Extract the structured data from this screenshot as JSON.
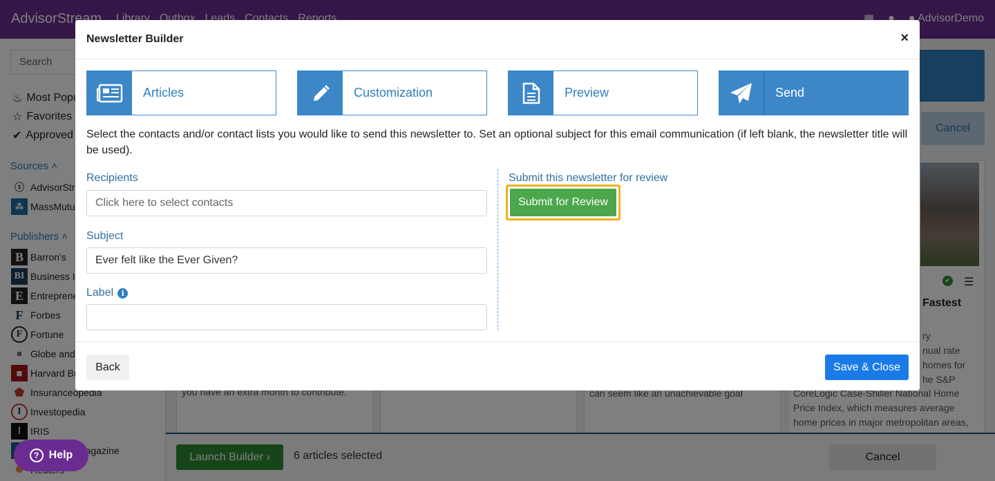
{
  "app": {
    "brand": "AdvisorStream",
    "nav": [
      "Library",
      "Outbox",
      "Leads",
      "Contacts",
      "Reports"
    ],
    "user": "AdvisorDemo"
  },
  "sidebar": {
    "search_placeholder": "Search",
    "filters": [
      "Most Popular",
      "Favorites",
      "Approved"
    ],
    "sources_heading": "Sources",
    "sources": [
      "AdvisorStream",
      "MassMutual"
    ],
    "publishers_heading": "Publishers",
    "publishers": [
      "Barron's",
      "Business Insider",
      "Entrepreneur",
      "Forbes",
      "Fortune",
      "Globe and Mail",
      "Harvard Business Review",
      "Insuranceopedia",
      "Investopedia",
      "IRIS",
      "Kiplinger's Magazine",
      "Reuters"
    ]
  },
  "background": {
    "cancel_top": "Cancel",
    "card_title_fragment": "Fastest",
    "card1_text": "you have an extra month to contribute.",
    "card3_text": "can seem like an unachievable goal",
    "card4_text": "CoreLogic Case-Shiller National Home Price Index, which measures average home prices in major metropolitan areas,",
    "card4_fragments": [
      "ry",
      "nual rate",
      "homes for",
      "he S&P"
    ]
  },
  "bottombar": {
    "launch_label": "Launch Builder",
    "selected_count": "6 articles selected",
    "cancel_label": "Cancel"
  },
  "help": {
    "label": "Help"
  },
  "modal": {
    "title": "Newsletter Builder",
    "close": "×",
    "steps": [
      {
        "label": "Articles",
        "icon": "newspaper-icon"
      },
      {
        "label": "Customization",
        "icon": "pencil-icon"
      },
      {
        "label": "Preview",
        "icon": "document-icon"
      },
      {
        "label": "Send",
        "icon": "paper-plane-icon"
      }
    ],
    "intro": "Select the contacts and/or contact lists you would like to send this newsletter to. Set an optional subject for this email communication (if left blank, the newsletter title will be used).",
    "recipients_label": "Recipients",
    "recipients_placeholder": "Click here to select contacts",
    "subject_label": "Subject",
    "subject_value": "Ever felt like the Ever Given?",
    "label_label": "Label",
    "label_value": "",
    "review_label": "Submit this newsletter for review",
    "review_button": "Submit for Review",
    "back_button": "Back",
    "save_button": "Save & Close"
  },
  "colors": {
    "brand_purple": "#6a2c91",
    "step_blue": "#3d87c8",
    "review_green": "#4ca64c",
    "highlight_orange": "#f2b01e",
    "save_blue": "#1a7be8"
  }
}
